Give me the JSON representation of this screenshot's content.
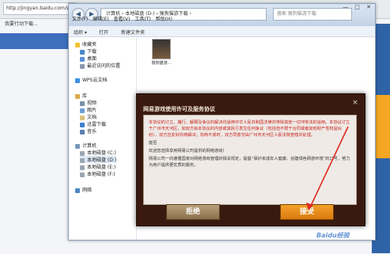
{
  "browser": {
    "url": "http://jingyan.baidu.com/soft/",
    "tab_label": "我要行动下载..."
  },
  "explorer": {
    "address": "计算机 › 本地磁盘 (D:) › 猴狗猫游下载 ›",
    "search_placeholder": "搜索 猴狗猫游下载",
    "menu": [
      "文件(F)",
      "编辑(E)",
      "查看(V)",
      "工具(T)",
      "帮助(H)"
    ],
    "toolbar": {
      "organize": "组织 ▾",
      "open": "打开",
      "new_folder": "新建文件夹"
    },
    "sidebar": {
      "favorites": "收藏夹",
      "downloads": "下载",
      "desktop": "桌面",
      "recent": "最近访问的位置",
      "wps": "WPS云文档",
      "libraries": "库",
      "videos": "视频",
      "pictures": "图片",
      "documents": "文档",
      "thunder": "迅雷下载",
      "music": "音乐",
      "computer": "计算机",
      "drive_c": "本地磁盘 (C:)",
      "drive_d": "本地磁盘 (D:)",
      "drive_e": "本地磁盘 (E:)",
      "drive_f": "本地磁盘 (F:)",
      "network": "网络"
    },
    "file_label": "猴狗猫游..."
  },
  "dialog": {
    "title": "网易游戏使用许可及服务协议",
    "close": "×",
    "paragraph1": "本协议的订立、履行、解释及争议的解决均适用中华人民共和国法律并排除其他一切冲突法的适用。本协议订立于广州市天河区，如双方就本协议的内容或其执行发生任何争议（包括但不限于合同或者其他财产性权益纠纷），双方应友好协商解决；协商不成时，双方同意交由广州市天河区人民法院管辖并处理。",
    "paragraph2": "能否",
    "paragraph3": "欢迎您选择享用网易公司提供的网络游戏！",
    "paragraph4": "网易公司一向遵循国家对网络游戏管理的相关规定，提倡“保护未成年人健康、创建绿色网游环境”的口号，努力为用户提供更优质的服务。",
    "reject_label": "拒绝",
    "accept_label": "接受"
  },
  "watermark": "Baidu经验",
  "colors": {
    "accept": "#e8891a",
    "reject": "#9c8058",
    "dialog_bg": "#3a1a10",
    "red_text": "#c8201a"
  }
}
